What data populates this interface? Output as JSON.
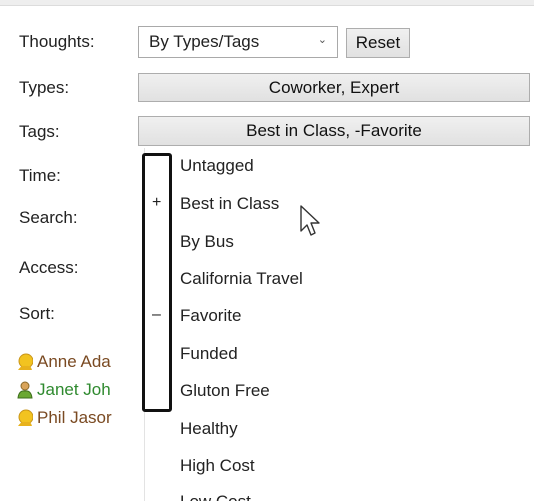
{
  "filters": {
    "thoughts": {
      "label": "Thoughts:",
      "selected": "By Types/Tags",
      "reset_label": "Reset"
    },
    "types": {
      "label": "Types:",
      "value": "Coworker, Expert"
    },
    "tags": {
      "label": "Tags:",
      "value": "Best in Class, -Favorite"
    },
    "time_label": "Time:",
    "search_label": "Search:",
    "access_label": "Access:",
    "sort_label": "Sort:"
  },
  "people": [
    {
      "name": "Anne Ada",
      "color": "#7a4a22",
      "icon": "person-yellow-icon"
    },
    {
      "name": "Janet Joh",
      "color": "#2f8a2f",
      "icon": "person-green-icon"
    },
    {
      "name": "Phil Jasor",
      "color": "#7a4a22",
      "icon": "person-yellow-icon"
    }
  ],
  "tag_menu": {
    "items": [
      {
        "label": "Untagged",
        "mark": ""
      },
      {
        "label": "Best in Class",
        "mark": "+"
      },
      {
        "label": "By Bus",
        "mark": ""
      },
      {
        "label": "California Travel",
        "mark": ""
      },
      {
        "label": "Favorite",
        "mark": "–"
      },
      {
        "label": "Funded",
        "mark": ""
      },
      {
        "label": "Gluton Free",
        "mark": ""
      },
      {
        "label": "Healthy",
        "mark": ""
      },
      {
        "label": "High Cost",
        "mark": ""
      },
      {
        "label": "Low Cost",
        "mark": ""
      }
    ]
  },
  "colors": {
    "button_bg": "#e5e5e5",
    "highlight_border": "#111111"
  }
}
